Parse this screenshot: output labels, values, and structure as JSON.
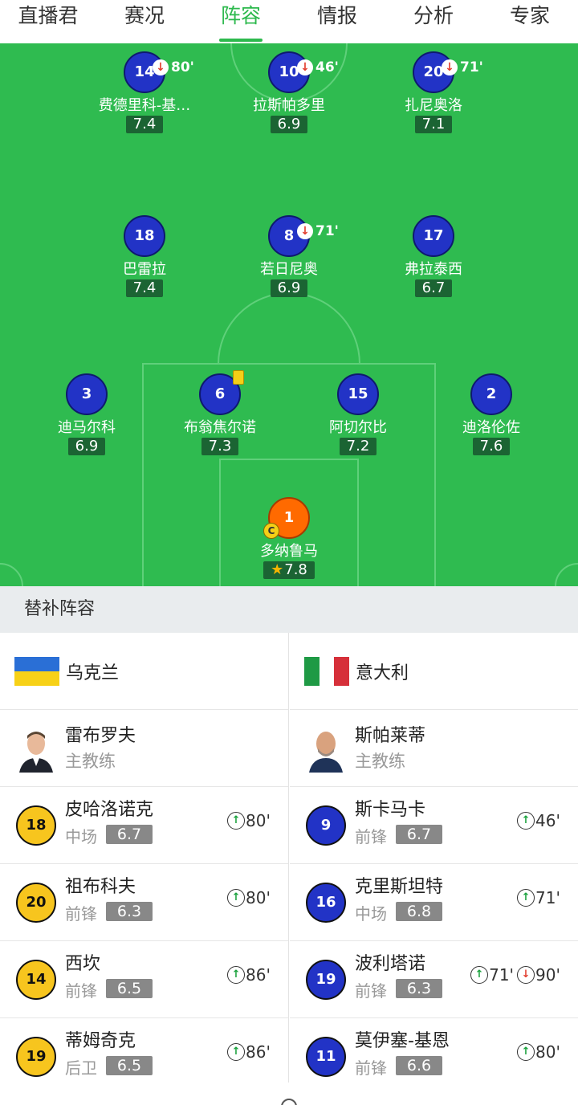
{
  "tabs": [
    "直播君",
    "赛况",
    "阵容",
    "情报",
    "分析",
    "专家"
  ],
  "active_tab": 2,
  "colors": {
    "accent": "#2db94d",
    "pitch": "#2fbb50",
    "player_blue": "#2233c6",
    "goalkeeper": "#ff6a00",
    "rating_bg": "#1b6433",
    "yellow": "#f7c51e"
  },
  "lineup": [
    {
      "number": "14",
      "name": "费德里科-基…",
      "rating": "7.4",
      "sub_off": "80'"
    },
    {
      "number": "10",
      "name": "拉斯帕多里",
      "rating": "6.9",
      "sub_off": "46'"
    },
    {
      "number": "20",
      "name": "扎尼奥洛",
      "rating": "7.1",
      "sub_off": "71'"
    },
    {
      "number": "18",
      "name": "巴雷拉",
      "rating": "7.4"
    },
    {
      "number": "8",
      "name": "若日尼奥",
      "rating": "6.9",
      "sub_off": "71'"
    },
    {
      "number": "17",
      "name": "弗拉泰西",
      "rating": "6.7"
    },
    {
      "number": "3",
      "name": "迪马尔科",
      "rating": "6.9"
    },
    {
      "number": "6",
      "name": "布翁焦尔诺",
      "rating": "7.3",
      "yellow_card": true
    },
    {
      "number": "15",
      "name": "阿切尔比",
      "rating": "7.2"
    },
    {
      "number": "2",
      "name": "迪洛伦佐",
      "rating": "7.6"
    },
    {
      "number": "1",
      "name": "多纳鲁马",
      "rating": "7.8",
      "captain": "C",
      "best": true
    }
  ],
  "subs_title": "替补阵容",
  "teams": [
    {
      "name": "乌克兰",
      "coach": {
        "name": "雷布罗夫",
        "role": "主教练"
      },
      "subs": [
        {
          "number": "18",
          "name": "皮哈洛诺克",
          "position": "中场",
          "rating": "6.7",
          "events": [
            {
              "type": "in",
              "time": "80'"
            }
          ]
        },
        {
          "number": "20",
          "name": "祖布科夫",
          "position": "前锋",
          "rating": "6.3",
          "events": [
            {
              "type": "in",
              "time": "80'"
            }
          ]
        },
        {
          "number": "14",
          "name": "西坎",
          "position": "前锋",
          "rating": "6.5",
          "events": [
            {
              "type": "in",
              "time": "86'"
            }
          ]
        },
        {
          "number": "19",
          "name": "蒂姆奇克",
          "position": "后卫",
          "rating": "6.5",
          "events": [
            {
              "type": "in",
              "time": "86'"
            }
          ]
        }
      ]
    },
    {
      "name": "意大利",
      "coach": {
        "name": "斯帕莱蒂",
        "role": "主教练"
      },
      "subs": [
        {
          "number": "9",
          "name": "斯卡马卡",
          "position": "前锋",
          "rating": "6.7",
          "events": [
            {
              "type": "in",
              "time": "46'"
            }
          ]
        },
        {
          "number": "16",
          "name": "克里斯坦特",
          "position": "中场",
          "rating": "6.8",
          "events": [
            {
              "type": "in",
              "time": "71'"
            }
          ]
        },
        {
          "number": "19",
          "name": "波利塔诺",
          "position": "前锋",
          "rating": "6.3",
          "events": [
            {
              "type": "in",
              "time": "71'"
            },
            {
              "type": "out",
              "time": "90'"
            }
          ]
        },
        {
          "number": "11",
          "name": "莫伊塞-基恩",
          "position": "前锋",
          "rating": "6.6",
          "events": [
            {
              "type": "in",
              "time": "80'"
            }
          ]
        }
      ]
    }
  ]
}
